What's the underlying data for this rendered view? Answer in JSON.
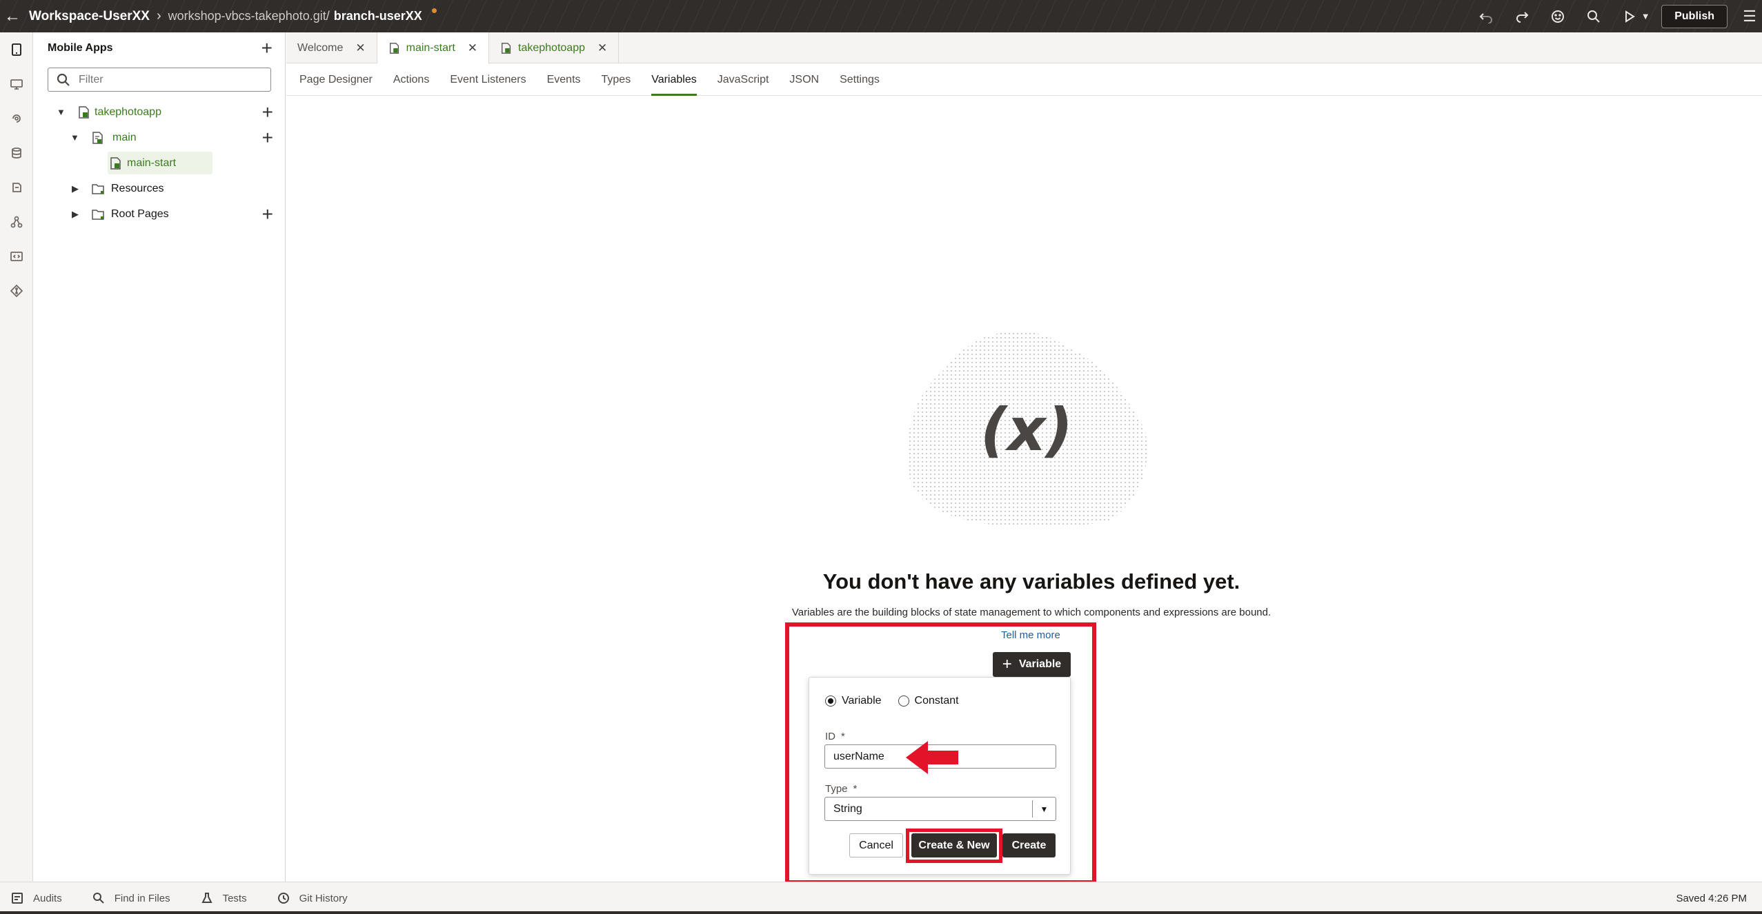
{
  "header": {
    "workspace": "Workspace-UserXX",
    "repo": "workshop-vbcs-takephoto.git/",
    "branch": "branch-userXX",
    "publish_label": "Publish"
  },
  "navigator": {
    "title": "Mobile Apps",
    "filter_placeholder": "Filter",
    "tree": [
      {
        "label": "takephotoapp"
      },
      {
        "label": "main"
      },
      {
        "label": "main-start"
      },
      {
        "label": "Resources"
      },
      {
        "label": "Root Pages"
      }
    ]
  },
  "editor_tabs": [
    {
      "label": "Welcome"
    },
    {
      "label": "main-start"
    },
    {
      "label": "takephotoapp"
    }
  ],
  "sub_tabs": [
    {
      "label": "Page Designer"
    },
    {
      "label": "Actions"
    },
    {
      "label": "Event Listeners"
    },
    {
      "label": "Events"
    },
    {
      "label": "Types"
    },
    {
      "label": "Variables"
    },
    {
      "label": "JavaScript"
    },
    {
      "label": "JSON"
    },
    {
      "label": "Settings"
    }
  ],
  "empty_state": {
    "illustration_text": "(x)",
    "title": "You don't have any variables defined yet.",
    "description": "Variables are the building blocks of state management to which components and expressions are bound.",
    "tell_more": "Tell me more",
    "add_button": "Variable"
  },
  "create_popup": {
    "radio_variable": "Variable",
    "radio_constant": "Constant",
    "selected_kind": "Variable",
    "id_label": "ID",
    "id_value": "userName",
    "type_label": "Type",
    "type_value": "String",
    "required_mark": "*",
    "cancel_label": "Cancel",
    "create_new_label": "Create & New",
    "create_label": "Create"
  },
  "bottom_bar": {
    "items": [
      {
        "label": "Audits"
      },
      {
        "label": "Find in Files"
      },
      {
        "label": "Tests"
      },
      {
        "label": "Git History"
      }
    ],
    "status": "Saved 4:26 PM"
  },
  "colors": {
    "accent_green": "#3c7a20",
    "highlight_red": "#e3132a",
    "header_bg": "#312d2a"
  }
}
